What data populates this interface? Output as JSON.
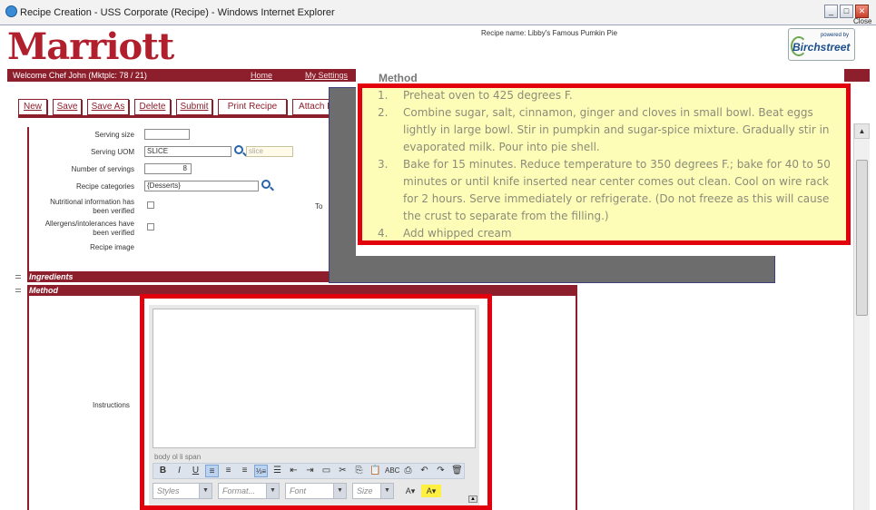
{
  "window": {
    "title": "Recipe Creation - USS Corporate (Recipe) - Windows Internet Explorer",
    "close_label": "Close"
  },
  "header": {
    "logo_text": "Marriott",
    "recipe_name": "Recipe name: Libby's Famous Pumkin Pie",
    "powered_by": "powered by",
    "brand": "Birchstreet"
  },
  "nav": {
    "welcome": "Welcome Chef John (Mktplc: 78 / 21)",
    "home": "Home",
    "settings": "My Settings"
  },
  "toolbar": {
    "buttons": [
      "New",
      "Save",
      "Save As",
      "Delete",
      "Submit",
      "Print Recipe",
      "Attach I"
    ]
  },
  "form": {
    "serving_size_label": "Serving size",
    "serving_uom_label": "Serving UOM",
    "serving_uom_value": "SLICE",
    "serving_uom_desc": "slice",
    "num_servings_label": "Number of servings",
    "num_servings_value": "8",
    "categories_label": "Recipe categories",
    "categories_value": "{Desserts}",
    "nutrition_label_1": "Nutritional information has",
    "nutrition_label_2": "been verified",
    "allergens_label_1": "Allergens/intolerances have",
    "allergens_label_2": "been verified",
    "image_label": "Recipe image",
    "cut_text": "To"
  },
  "sections": {
    "ingredients": "Ingredients",
    "method": "Method"
  },
  "editor": {
    "instructions_label": "Instructions",
    "path": "body   ol   li   span",
    "styles_placeholder": "Styles",
    "format_placeholder": "Format...",
    "font_placeholder": "Font",
    "size_placeholder": "Size"
  },
  "method_popup": {
    "heading": "Method",
    "steps": [
      "Preheat oven to 425 degrees F.",
      "Combine sugar, salt, cinnamon, ginger and cloves in small bowl. Beat eggs lightly in large bowl. Stir in pumpkin and sugar-spice mixture. Gradually stir in evaporated milk. Pour into pie shell.",
      "Bake for 15 minutes. Reduce temperature to 350 degrees F.; bake for 40 to 50 minutes or until knife inserted near center comes out clean. Cool on wire rack for 2 hours. Serve immediately or refrigerate. (Do not freeze as this will cause the crust to separate from the filling.)",
      "Add whipped cream"
    ],
    "numbers": [
      "1.",
      "2.",
      "3.",
      "4."
    ]
  },
  "colors": {
    "brand_red": "#8d1f2d",
    "highlight_red": "#e2000d",
    "note_yellow": "#fdfdb8"
  }
}
